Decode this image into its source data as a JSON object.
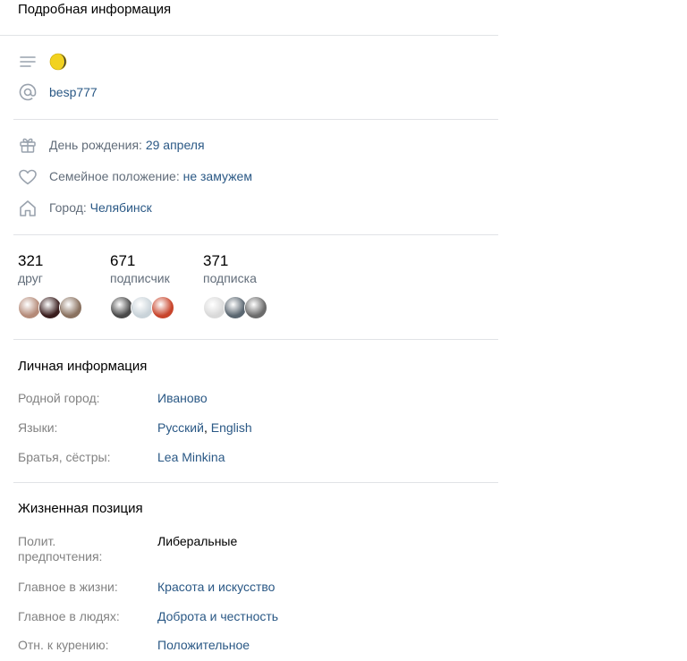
{
  "header": {
    "title": "Подробная информация"
  },
  "status": {
    "username": "besp777"
  },
  "info": {
    "birthday_label": "День рождения: ",
    "birthday_value": "29 апреля",
    "marital_label": "Семейное положение: ",
    "marital_value": "не замужем",
    "city_label": "Город: ",
    "city_value": "Челябинск"
  },
  "counters": [
    {
      "number": "321",
      "label": "друг"
    },
    {
      "number": "671",
      "label": "подписчик"
    },
    {
      "number": "371",
      "label": "подписка"
    }
  ],
  "avatar_colors": [
    [
      "#b48a78",
      "#3a1e1e",
      "#8a7260"
    ],
    [
      "#4a4a4a",
      "#c9d3d9",
      "#c8452c"
    ],
    [
      "#d9d9d9",
      "#5a6670",
      "#6b6b6b"
    ]
  ],
  "personal": {
    "title": "Личная информация",
    "hometown_label": "Родной город:",
    "hometown_value": "Иваново",
    "languages_label": "Языки:",
    "language_1": "Русский",
    "language_sep": ", ",
    "language_2": "English",
    "siblings_label": "Братья, сёстры:",
    "siblings_value": "Lea Minkina"
  },
  "life": {
    "title": "Жизненная позиция",
    "politics_label": "Полит. предпочтения:",
    "politics_value": "Либеральные",
    "main_life_label": "Главное в жизни:",
    "main_life_value": "Красота и искусство",
    "main_people_label": "Главное в людях:",
    "main_people_value": "Доброта и честность",
    "smoking_label": "Отн. к курению:",
    "smoking_value": "Положительное"
  },
  "colors": {
    "link": "#2a5885",
    "muted": "#626d7a",
    "separator": "#e1e3e6",
    "moon": "#f2d21f"
  }
}
